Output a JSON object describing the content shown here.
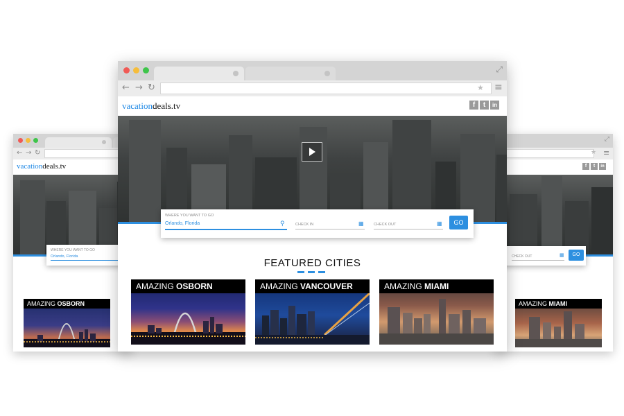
{
  "site": {
    "logo_accent": "vacation",
    "logo_rest": "deals.tv"
  },
  "social_icons": [
    {
      "name": "facebook-icon",
      "glyph": "f"
    },
    {
      "name": "twitter-icon",
      "glyph": "t"
    },
    {
      "name": "linkedin-icon",
      "glyph": "in"
    }
  ],
  "search": {
    "destination_label": "WHERE YOU WANT TO GO",
    "destination_value": "Orlando, Florida",
    "checkin_placeholder": "CHECK IN",
    "checkout_placeholder": "CHECK OUT",
    "go_label": "GO"
  },
  "featured": {
    "title": "FEATURED CITIES",
    "cities": [
      {
        "prefix": "AMAZING",
        "name": "OSBORN"
      },
      {
        "prefix": "AMAZING",
        "name": "VANCOUVER"
      },
      {
        "prefix": "AMAZING",
        "name": "MIAMI"
      }
    ]
  },
  "colors": {
    "accent": "#2d8fe0",
    "chrome": "#d4d4d4",
    "traffic_red": "#f05a55",
    "traffic_yellow": "#f6bd3b",
    "traffic_green": "#3ec54a"
  }
}
